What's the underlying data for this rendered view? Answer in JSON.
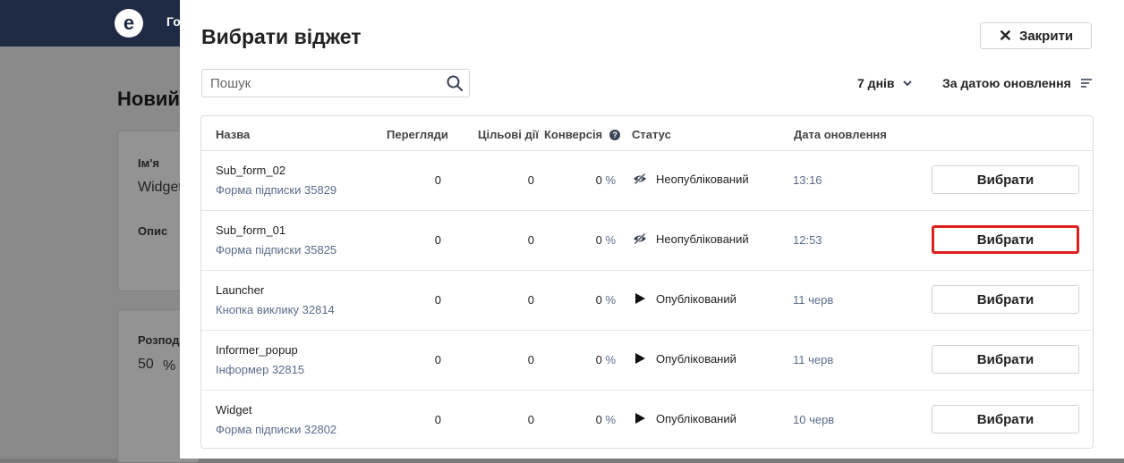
{
  "background": {
    "logo_letter": "e",
    "nav_item": "Го",
    "page_title": "Новий",
    "name_label": "Ім'я",
    "name_value": "Widget",
    "description_label": "Опис",
    "distribution_label": "Розпод",
    "distribution_value": "50",
    "distribution_unit": "%"
  },
  "modal": {
    "title": "Вибрати віджет",
    "close_label": "Закрити",
    "search_placeholder": "Пошук",
    "period_label": "7 днів",
    "sort_label": "За датою оновлення",
    "columns": {
      "name": "Назва",
      "views": "Перегляди",
      "actions": "Цільові дії",
      "conversion": "Конверсія",
      "status": "Статус",
      "updated": "Дата оновлення"
    },
    "select_label": "Вибрати",
    "rows": [
      {
        "name": "Sub_form_02",
        "type": "Форма підписки 35829",
        "views": "0",
        "actions": "0",
        "conversion": "0",
        "conv_unit": "%",
        "status": "Неопублікований",
        "status_icon": "eye-off-icon",
        "date": "13:16",
        "highlighted": false
      },
      {
        "name": "Sub_form_01",
        "type": "Форма підписки 35825",
        "views": "0",
        "actions": "0",
        "conversion": "0",
        "conv_unit": "%",
        "status": "Неопублікований",
        "status_icon": "eye-off-icon",
        "date": "12:53",
        "highlighted": true
      },
      {
        "name": "Launcher",
        "type": "Кнопка виклику 32814",
        "views": "0",
        "actions": "0",
        "conversion": "0",
        "conv_unit": "%",
        "status": "Опублікований",
        "status_icon": "play-icon",
        "date": "11 черв",
        "highlighted": false
      },
      {
        "name": "Informer_popup",
        "type": "Інформер 32815",
        "views": "0",
        "actions": "0",
        "conversion": "0",
        "conv_unit": "%",
        "status": "Опублікований",
        "status_icon": "play-icon",
        "date": "11 черв",
        "highlighted": false
      },
      {
        "name": "Widget",
        "type": "Форма підписки 32802",
        "views": "0",
        "actions": "0",
        "conversion": "0",
        "conv_unit": "%",
        "status": "Опублікований",
        "status_icon": "play-icon",
        "date": "10 черв",
        "highlighted": false
      }
    ]
  },
  "colors": {
    "highlight": "#e02020",
    "topbar": "#1f2a44",
    "muted_text": "#5a6c8a"
  }
}
